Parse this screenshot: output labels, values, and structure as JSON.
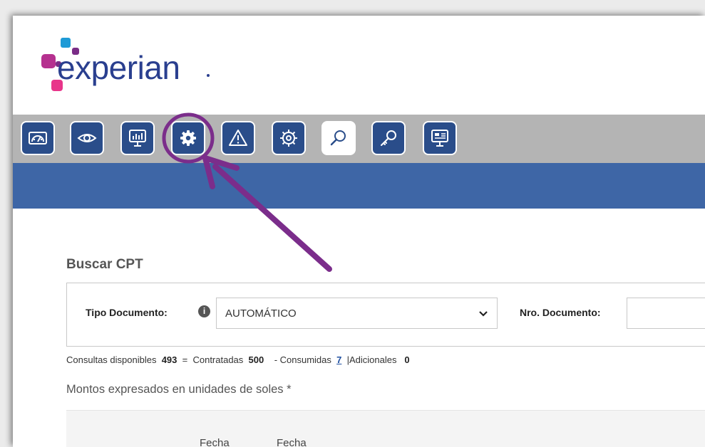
{
  "brand": {
    "name": "experian",
    "colors": {
      "dark_blue": "#2a3f8f",
      "pink": "#e8358a",
      "purple": "#7a2c86",
      "light_blue": "#1e9ad6",
      "magenta": "#b5318f"
    }
  },
  "toolbar": {
    "background": "#b4b4b4",
    "buttons": [
      {
        "icon": "dashboard-icon"
      },
      {
        "icon": "eye-icon"
      },
      {
        "icon": "monitor-chart-icon"
      },
      {
        "icon": "gear-icon",
        "highlighted": true
      },
      {
        "icon": "warning-icon"
      },
      {
        "icon": "cog-badge-icon"
      },
      {
        "icon": "search-icon",
        "active": true
      },
      {
        "icon": "key-icon"
      },
      {
        "icon": "screen-report-icon"
      }
    ]
  },
  "annotation": {
    "color": "#7b2d8b"
  },
  "header_bar": {
    "color": "#3e66a6"
  },
  "search": {
    "title": "Buscar CPT",
    "tipo_documento_label": "Tipo Documento:",
    "info_symbol": "i",
    "tipo_documento_value": "AUTOMÁTICO",
    "chevron": "⌄",
    "nro_documento_label": "Nro. Documento:",
    "nro_documento_value": ""
  },
  "stats": {
    "disponibles_label": "Consultas disponibles",
    "disponibles_value": "493",
    "eq": "=",
    "contratadas_label": "Contratadas",
    "contratadas_value": "500",
    "consumidas_label": "- Consumidas",
    "consumidas_value": "7",
    "sep": "|",
    "adicionales_label": "Adicionales",
    "adicionales_value": "0"
  },
  "note": "Montos expresados en unidades de soles *",
  "table": {
    "headers": [
      "Fecha",
      "Fecha"
    ]
  }
}
